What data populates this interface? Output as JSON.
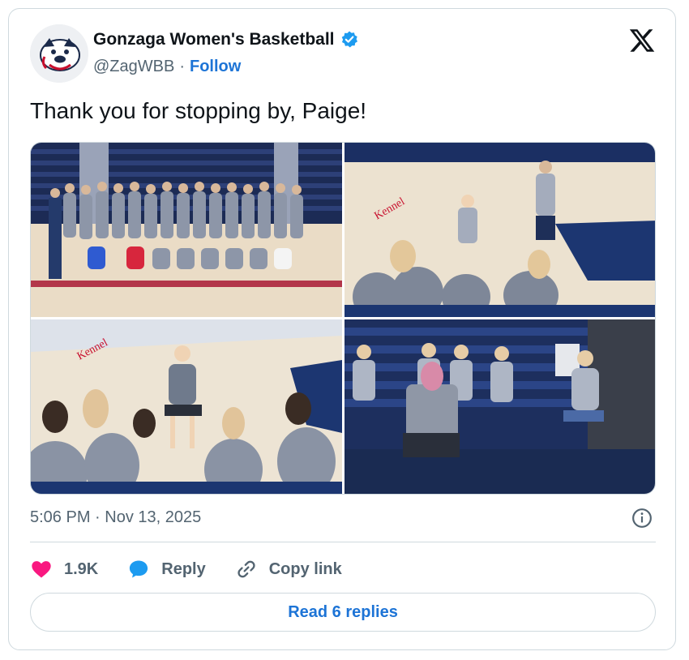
{
  "tweet": {
    "display_name": "Gonzaga Women's Basketball",
    "handle": "@ZagWBB",
    "separator": "·",
    "follow_label": "Follow",
    "text": "Thank you for stopping by, Paige!",
    "timestamp": "5:06 PM · Nov 13, 2025"
  },
  "actions": {
    "likes": "1.9K",
    "reply_label": "Reply",
    "copy_link_label": "Copy link"
  },
  "footer": {
    "read_replies_label": "Read 6 replies"
  },
  "colors": {
    "link_blue": "#1d74d6",
    "verified_blue": "#1d9bf0",
    "heart_pink": "#f91880",
    "muted_gray": "#536471",
    "border": "#cfd9de"
  },
  "icons": {
    "avatar": "bulldog-logo",
    "verified": "verified-badge-icon",
    "platform": "x-logo-icon",
    "like": "heart-icon",
    "reply": "speech-bubble-icon",
    "copy": "link-icon",
    "info": "info-icon"
  }
}
